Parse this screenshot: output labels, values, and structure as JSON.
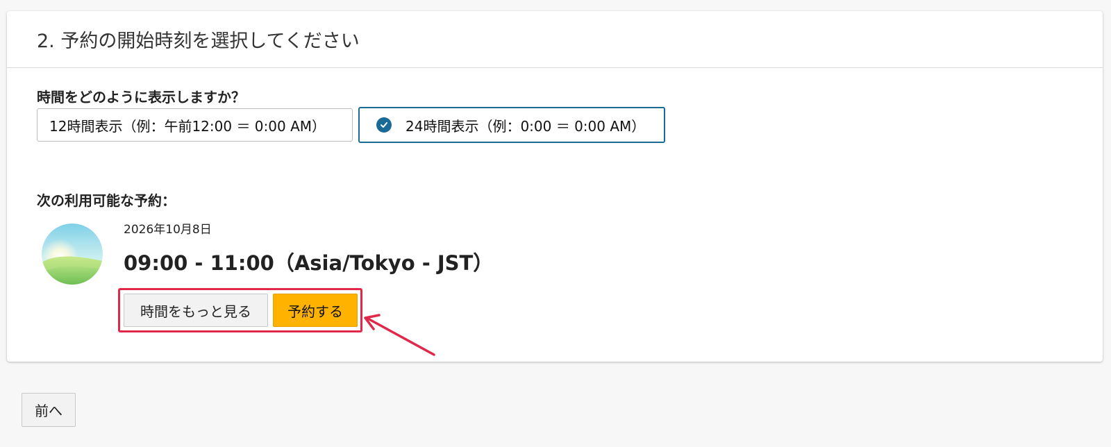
{
  "section": {
    "title": "2. 予約の開始時刻を選択してください"
  },
  "time_format": {
    "question": "時間をどのように表示しますか？",
    "options": [
      {
        "label": "12時間表示（例：午前12:00 ＝ 0:00 AM）",
        "selected": false
      },
      {
        "label": "24時間表示（例：0:00 ＝ 0:00 AM）",
        "selected": true
      }
    ],
    "selected_icon": "check-circle-icon"
  },
  "next_available": {
    "heading": "次の利用可能な予約：",
    "avatar_icon": "sunrise-landscape-icon",
    "date": "2026年10月8日",
    "time": "09:00 - 11:00（Asia/Tokyo - JST）",
    "more_times_label": "時間をもっと見る",
    "book_label": "予約する"
  },
  "navigation": {
    "prev_label": "前へ"
  },
  "colors": {
    "accent": "#1b6a96",
    "book_button": "#ffb300",
    "annotation": "#e0284a"
  }
}
